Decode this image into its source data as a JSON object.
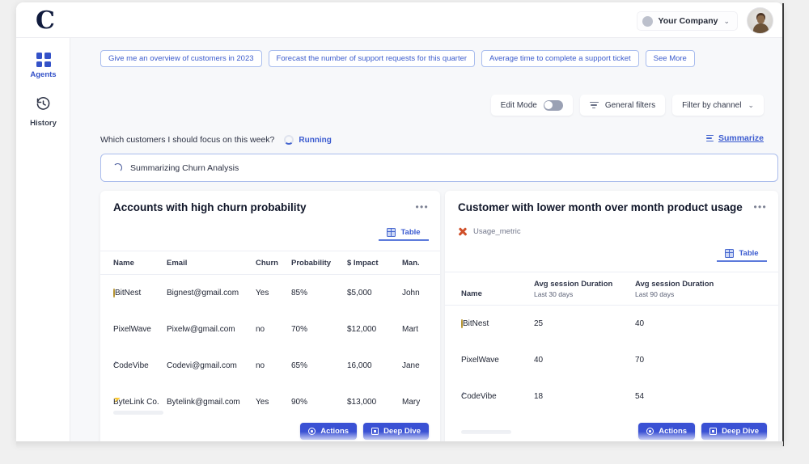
{
  "app": {
    "logo_text": "C",
    "company_name": "Your Company",
    "company_chevron": "⌄"
  },
  "sidebar": {
    "items": [
      {
        "label": "Agents",
        "icon": "grid-icon",
        "active": true
      },
      {
        "label": "History",
        "icon": "history-clock-icon",
        "active": false
      }
    ]
  },
  "suggestions": {
    "chips": [
      "Give me an overview of customers in 2023",
      "Forecast the number of support requests for this quarter",
      "Average time to complete a support ticket",
      "See More"
    ]
  },
  "controls": {
    "edit_mode_label": "Edit Mode",
    "edit_mode_on": false,
    "general_filters_label": "General filters",
    "filter_by_channel_label": "Filter by channel",
    "filter_chevron": "⌄"
  },
  "query": {
    "text": "Which customers I should focus on this week?",
    "status_label": "Running",
    "summarize_label": "Summarize"
  },
  "status_banner": {
    "text": "Summarizing Churn Analysis"
  },
  "cards": [
    {
      "id": "churn",
      "title": "Accounts with high churn probability",
      "kebab": "•••",
      "tab_label": "Table",
      "columns": [
        "Name",
        "Email",
        "Churn",
        "Probability",
        "$ Impact",
        "Man."
      ],
      "rows": [
        {
          "icon": "coin-badge-icon",
          "name": "BitNest",
          "email": "Bignest@gmail.com",
          "churn": "Yes",
          "probability": "85%",
          "impact": "$5,000",
          "manager": "John"
        },
        {
          "icon": "grid-badge-icon",
          "name": "PixelWave",
          "email": "Pixelw@gmail.com",
          "churn": "no",
          "probability": "70%",
          "impact": "$12,000",
          "manager": "Mart"
        },
        {
          "icon": "chevron-badge-icon",
          "name": "CodeVibe",
          "email": "Codevi@gmail.com",
          "churn": "no",
          "probability": "65%",
          "impact": "16,000",
          "manager": "Jane"
        },
        {
          "icon": "bolt-badge-icon",
          "name": "ByteLink Co.",
          "email": "Bytelink@gmail.com",
          "churn": "Yes",
          "probability": "90%",
          "impact": "$13,000",
          "manager": "Mary"
        }
      ],
      "actions_label": "Actions",
      "deep_dive_label": "Deep Dive"
    },
    {
      "id": "usage",
      "title": "Customer with lower month over month product usage",
      "kebab": "•••",
      "metric_chip": "Usage_metric",
      "tab_label": "Table",
      "columns": [
        {
          "main": "Name",
          "sub": ""
        },
        {
          "main": "Avg session Duration",
          "sub": "Last 30 days"
        },
        {
          "main": "Avg session Duration",
          "sub": "Last 90 days"
        }
      ],
      "rows": [
        {
          "icon": "coin-badge-icon",
          "name": "BitNest",
          "d30": "25",
          "d90": "40"
        },
        {
          "icon": "grid-badge-icon",
          "name": "PixelWave",
          "d30": "40",
          "d90": "70"
        },
        {
          "icon": "chevron-badge-icon",
          "name": "CodeVibe",
          "d30": "18",
          "d90": "54"
        }
      ],
      "actions_label": "Actions",
      "deep_dive_label": "Deep Dive"
    }
  ],
  "colors": {
    "accent_blue": "#3a51d4",
    "link_blue": "#3b5bd0",
    "canvas": "#f7f8fa",
    "metric_orange": "#d0502a"
  }
}
